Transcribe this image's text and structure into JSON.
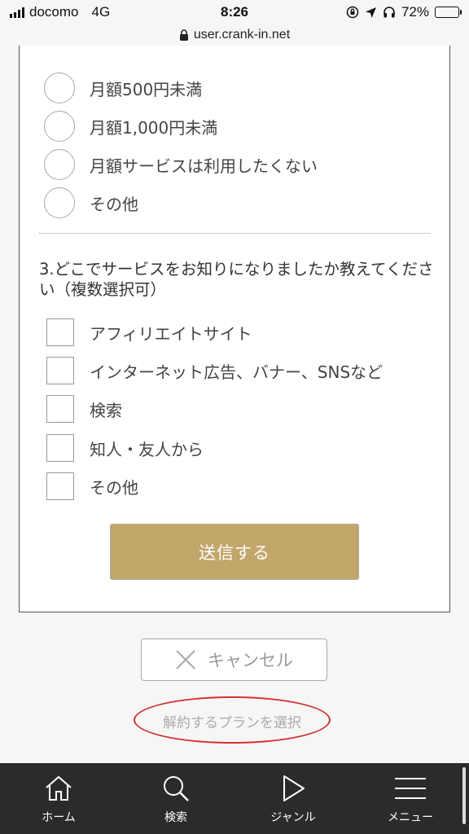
{
  "status_bar": {
    "carrier": "docomo",
    "network": "4G",
    "time": "8:26",
    "battery": "72%",
    "battery_level": 0.72
  },
  "browser": {
    "url": "user.crank-in.net"
  },
  "q2_options": [
    "月額500円未満",
    "月額1,000円未満",
    "月額サービスは利用したくない",
    "その他"
  ],
  "q3": {
    "question": "3.どこでサービスをお知りになりましたか教えてください（複数選択可）",
    "options": [
      "アフィリエイトサイト",
      "インターネット広告、バナー、SNSなど",
      "検索",
      "知人・友人から",
      "その他"
    ]
  },
  "form": {
    "submit_label": "送信する"
  },
  "actions": {
    "cancel_label": "キャンセル",
    "select_plan_label": "解約するプランを選択"
  },
  "bottom_nav": [
    {
      "label": "ホーム",
      "icon": "home-icon"
    },
    {
      "label": "検索",
      "icon": "search-icon"
    },
    {
      "label": "ジャンル",
      "icon": "play-icon"
    },
    {
      "label": "メニュー",
      "icon": "menu-icon"
    }
  ],
  "colors": {
    "accent": "#c2a66a",
    "annotation": "#d3312b",
    "nav_bg": "#2b2b2b"
  }
}
